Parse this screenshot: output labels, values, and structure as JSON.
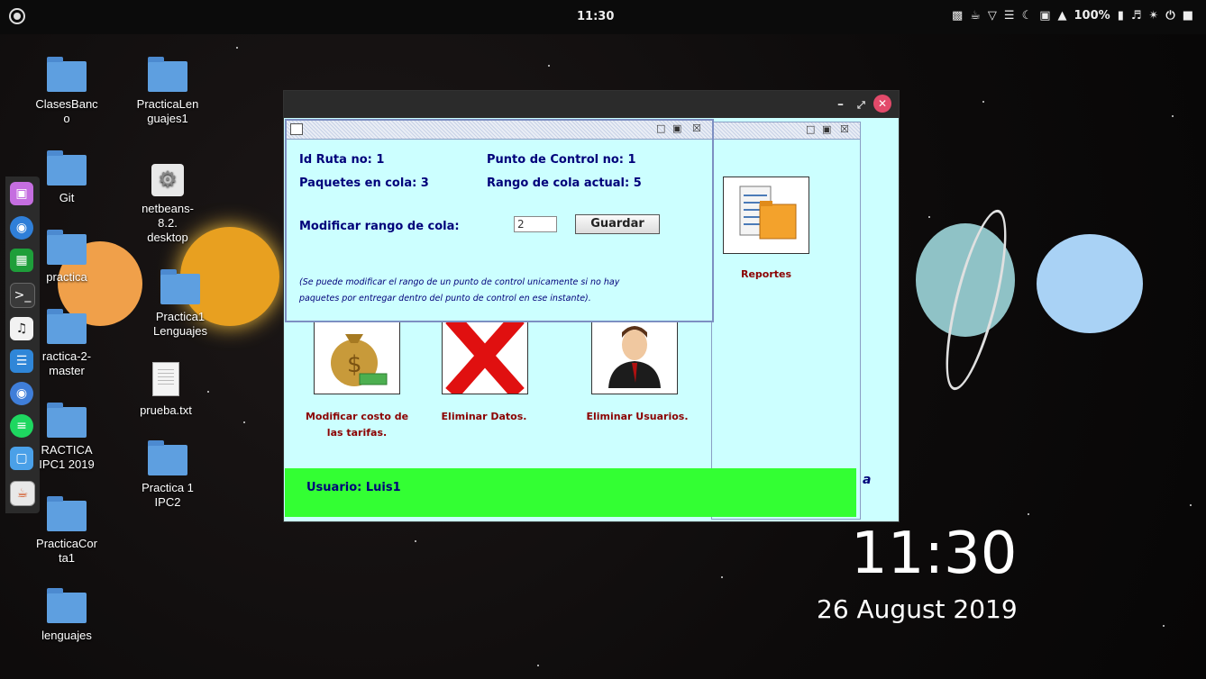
{
  "topbar": {
    "time": "11:30",
    "battery": "100%"
  },
  "desktop_icons": {
    "clasesbanco": "ClasesBanc\no",
    "practicalenguajes1": "PracticaLen\nguajes1",
    "git": "Git",
    "netbeans": "netbeans-\n8.2.\ndesktop",
    "practica": "practica",
    "practica1lenguajes": "Practica1\nLenguajes",
    "practica2master": "ractica-2-\nmaster",
    "pruebatxt": "prueba.txt",
    "practicaipc12019": "RACTICA\nIPC1 2019",
    "practica1ipc2": "Practica 1\nIPC2",
    "practicacorta1": "PracticaCor\nta1",
    "lenguajes": "lenguajes"
  },
  "dialog": {
    "id_ruta": "Id Ruta no: 1",
    "punto_control": "Punto de Control no: 1",
    "paquetes_cola": "Paquetes en cola: 3",
    "rango_actual": "Rango de cola actual: 5",
    "modificar_label": "Modificar rango de cola:",
    "input_value": "2",
    "guardar": "Guardar",
    "note_line1": "(Se puede modificar el rango de un punto de control unicamente si no hay",
    "note_line2": "paquetes por entregar dentro del punto de control en ese instante)."
  },
  "main": {
    "reportes": "Reportes",
    "modificar_costo": "Modificar costo de",
    "modificar_costo2": "las tarifas.",
    "eliminar_datos": "Eliminar Datos.",
    "eliminar_usuarios": "Eliminar Usuarios.",
    "usuario": "Usuario: Luis1",
    "clipped_letter": "a"
  },
  "bigclock": {
    "time": "11:30",
    "date": "26 August 2019"
  },
  "colors": {
    "window_bg": "#ccffff",
    "status_bar": "#33ff33",
    "label_blue": "#00007a",
    "label_red": "#8b0000"
  }
}
